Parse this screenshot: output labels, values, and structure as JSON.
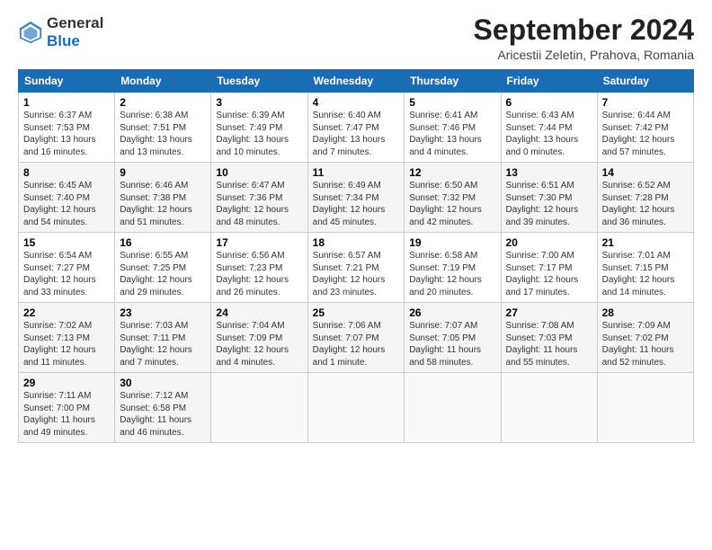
{
  "header": {
    "logo_general": "General",
    "logo_blue": "Blue",
    "month_year": "September 2024",
    "location": "Aricestii Zeletin, Prahova, Romania"
  },
  "days_of_week": [
    "Sunday",
    "Monday",
    "Tuesday",
    "Wednesday",
    "Thursday",
    "Friday",
    "Saturday"
  ],
  "weeks": [
    [
      {
        "day": "1",
        "info": "Sunrise: 6:37 AM\nSunset: 7:53 PM\nDaylight: 13 hours\nand 16 minutes."
      },
      {
        "day": "2",
        "info": "Sunrise: 6:38 AM\nSunset: 7:51 PM\nDaylight: 13 hours\nand 13 minutes."
      },
      {
        "day": "3",
        "info": "Sunrise: 6:39 AM\nSunset: 7:49 PM\nDaylight: 13 hours\nand 10 minutes."
      },
      {
        "day": "4",
        "info": "Sunrise: 6:40 AM\nSunset: 7:47 PM\nDaylight: 13 hours\nand 7 minutes."
      },
      {
        "day": "5",
        "info": "Sunrise: 6:41 AM\nSunset: 7:46 PM\nDaylight: 13 hours\nand 4 minutes."
      },
      {
        "day": "6",
        "info": "Sunrise: 6:43 AM\nSunset: 7:44 PM\nDaylight: 13 hours\nand 0 minutes."
      },
      {
        "day": "7",
        "info": "Sunrise: 6:44 AM\nSunset: 7:42 PM\nDaylight: 12 hours\nand 57 minutes."
      }
    ],
    [
      {
        "day": "8",
        "info": "Sunrise: 6:45 AM\nSunset: 7:40 PM\nDaylight: 12 hours\nand 54 minutes."
      },
      {
        "day": "9",
        "info": "Sunrise: 6:46 AM\nSunset: 7:38 PM\nDaylight: 12 hours\nand 51 minutes."
      },
      {
        "day": "10",
        "info": "Sunrise: 6:47 AM\nSunset: 7:36 PM\nDaylight: 12 hours\nand 48 minutes."
      },
      {
        "day": "11",
        "info": "Sunrise: 6:49 AM\nSunset: 7:34 PM\nDaylight: 12 hours\nand 45 minutes."
      },
      {
        "day": "12",
        "info": "Sunrise: 6:50 AM\nSunset: 7:32 PM\nDaylight: 12 hours\nand 42 minutes."
      },
      {
        "day": "13",
        "info": "Sunrise: 6:51 AM\nSunset: 7:30 PM\nDaylight: 12 hours\nand 39 minutes."
      },
      {
        "day": "14",
        "info": "Sunrise: 6:52 AM\nSunset: 7:28 PM\nDaylight: 12 hours\nand 36 minutes."
      }
    ],
    [
      {
        "day": "15",
        "info": "Sunrise: 6:54 AM\nSunset: 7:27 PM\nDaylight: 12 hours\nand 33 minutes."
      },
      {
        "day": "16",
        "info": "Sunrise: 6:55 AM\nSunset: 7:25 PM\nDaylight: 12 hours\nand 29 minutes."
      },
      {
        "day": "17",
        "info": "Sunrise: 6:56 AM\nSunset: 7:23 PM\nDaylight: 12 hours\nand 26 minutes."
      },
      {
        "day": "18",
        "info": "Sunrise: 6:57 AM\nSunset: 7:21 PM\nDaylight: 12 hours\nand 23 minutes."
      },
      {
        "day": "19",
        "info": "Sunrise: 6:58 AM\nSunset: 7:19 PM\nDaylight: 12 hours\nand 20 minutes."
      },
      {
        "day": "20",
        "info": "Sunrise: 7:00 AM\nSunset: 7:17 PM\nDaylight: 12 hours\nand 17 minutes."
      },
      {
        "day": "21",
        "info": "Sunrise: 7:01 AM\nSunset: 7:15 PM\nDaylight: 12 hours\nand 14 minutes."
      }
    ],
    [
      {
        "day": "22",
        "info": "Sunrise: 7:02 AM\nSunset: 7:13 PM\nDaylight: 12 hours\nand 11 minutes."
      },
      {
        "day": "23",
        "info": "Sunrise: 7:03 AM\nSunset: 7:11 PM\nDaylight: 12 hours\nand 7 minutes."
      },
      {
        "day": "24",
        "info": "Sunrise: 7:04 AM\nSunset: 7:09 PM\nDaylight: 12 hours\nand 4 minutes."
      },
      {
        "day": "25",
        "info": "Sunrise: 7:06 AM\nSunset: 7:07 PM\nDaylight: 12 hours\nand 1 minute."
      },
      {
        "day": "26",
        "info": "Sunrise: 7:07 AM\nSunset: 7:05 PM\nDaylight: 11 hours\nand 58 minutes."
      },
      {
        "day": "27",
        "info": "Sunrise: 7:08 AM\nSunset: 7:03 PM\nDaylight: 11 hours\nand 55 minutes."
      },
      {
        "day": "28",
        "info": "Sunrise: 7:09 AM\nSunset: 7:02 PM\nDaylight: 11 hours\nand 52 minutes."
      }
    ],
    [
      {
        "day": "29",
        "info": "Sunrise: 7:11 AM\nSunset: 7:00 PM\nDaylight: 11 hours\nand 49 minutes."
      },
      {
        "day": "30",
        "info": "Sunrise: 7:12 AM\nSunset: 6:58 PM\nDaylight: 11 hours\nand 46 minutes."
      },
      null,
      null,
      null,
      null,
      null
    ]
  ]
}
